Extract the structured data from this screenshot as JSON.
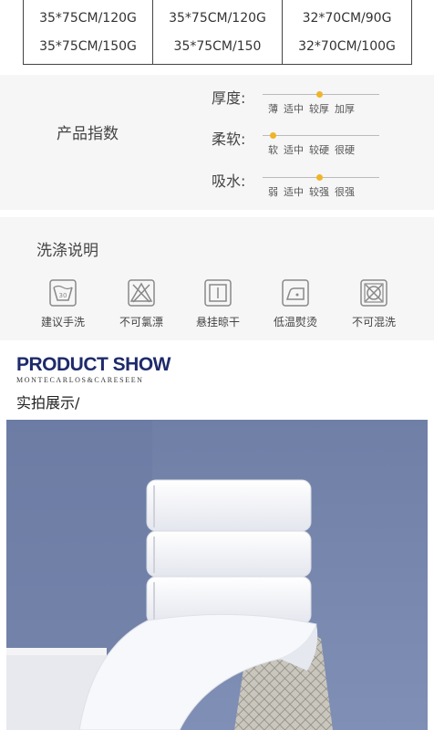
{
  "spec_table": {
    "columns": [
      [
        "35*75CM/120G",
        "35*75CM/150G"
      ],
      [
        "35*75CM/120G",
        "35*75CM/150"
      ],
      [
        "32*70CM/90G",
        "32*70CM/100G"
      ]
    ]
  },
  "product_index": {
    "title": "产品指数",
    "rows": [
      {
        "label": "厚度:",
        "levels": [
          "薄",
          "适中",
          "较厚",
          "加厚"
        ],
        "selected_index": 2
      },
      {
        "label": "柔软:",
        "levels": [
          "软",
          "适中",
          "较硬",
          "很硬"
        ],
        "selected_index": 0
      },
      {
        "label": "吸水:",
        "levels": [
          "弱",
          "适中",
          "较强",
          "很强"
        ],
        "selected_index": 2
      }
    ],
    "accent_color": "#f0b429"
  },
  "wash": {
    "title": "洗涤说明",
    "items": [
      {
        "icon": "hand-wash-30-icon",
        "label": "建议手洗",
        "badge": "30"
      },
      {
        "icon": "no-bleach-icon",
        "label": "不可氯漂"
      },
      {
        "icon": "hang-dry-icon",
        "label": "悬挂晾干"
      },
      {
        "icon": "low-temp-iron-icon",
        "label": "低温熨烫"
      },
      {
        "icon": "no-mixed-wash-icon",
        "label": "不可混洗"
      }
    ]
  },
  "product_show": {
    "title": "PRODUCT SHOW",
    "subtitle": "MONTECARLOS&CARESEEN",
    "caption": "实拍展示/",
    "title_color": "#1e2a6b"
  },
  "photo": {
    "description_icon": "stacked-white-towels-photo"
  }
}
